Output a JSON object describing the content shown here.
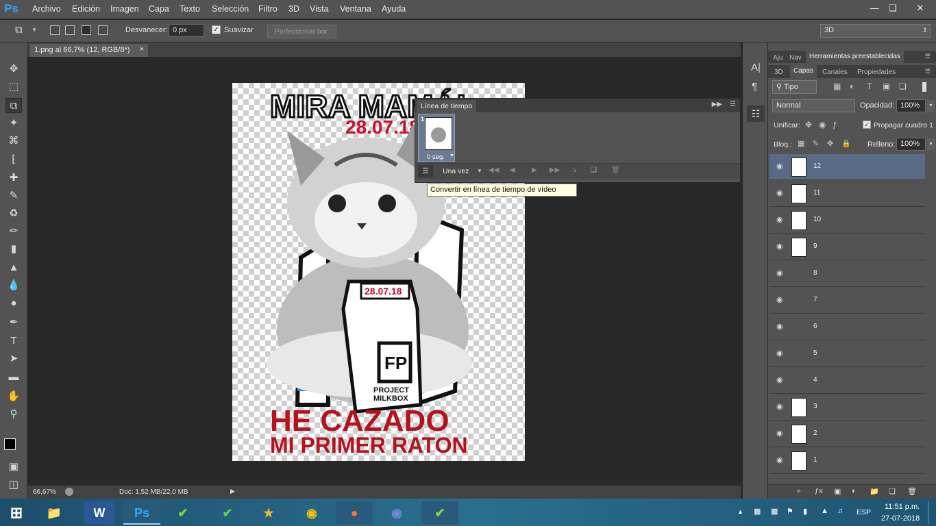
{
  "app": {
    "logo": "Ps"
  },
  "menu": [
    "Archivo",
    "Edición",
    "Imagen",
    "Capa",
    "Texto",
    "Selección",
    "Filtro",
    "3D",
    "Vista",
    "Ventana",
    "Ayuda"
  ],
  "options": {
    "feather_label": "Desvanecer:",
    "feather_value": "0 px",
    "smooth_label": "Suavizar",
    "refine_label": "Perfeccionar bor.",
    "workspace": "3D"
  },
  "document": {
    "tab_title": "1.png al 66,7% (12, RGB/8*)",
    "zoom": "66,67%",
    "doc_info": "Doc: 1,52 MB/22,0 MB",
    "poster_title": "MIRA MAMÁ!",
    "poster_date": "28.07.18",
    "poster_bottom_1": "HE CAZADO",
    "poster_bottom_2": "MI PRIMER RATON",
    "carton_date": "28.07.18",
    "carton_brand_1": "PROJECT",
    "carton_brand_2": "MILKBOX"
  },
  "timeline": {
    "tab": "Línea de tiempo",
    "frame_number": "1",
    "frame_delay": "0 seg.",
    "loop": "Una vez",
    "tooltip": "Convertir en línea de tiempo de vídeo"
  },
  "right_panel": {
    "top_tabs": [
      "Aju",
      "Nav",
      "Herramientas preestablecidas"
    ],
    "tabs": [
      "3D",
      "Capas",
      "Canales",
      "Propiedades"
    ],
    "filter_kind": "Tipo",
    "blend_mode": "Normal",
    "opacity_label": "Opacidad:",
    "opacity_value": "100%",
    "unify_label": "Unificar:",
    "propagate_label": "Propagar cuadro 1",
    "lock_label": "Bloq.:",
    "fill_label": "Relleno:",
    "fill_value": "100%",
    "layers": [
      "12",
      "11",
      "10",
      "9",
      "8",
      "7",
      "6",
      "5",
      "4",
      "3",
      "2",
      "1"
    ]
  },
  "taskbar": {
    "lang": "ESP",
    "time": "11:51 p.m.",
    "date": "27-07-2018"
  },
  "colors": {
    "accent": "#30a8ff",
    "selected_layer": "#586a85",
    "poster_red": "#b3121e"
  }
}
